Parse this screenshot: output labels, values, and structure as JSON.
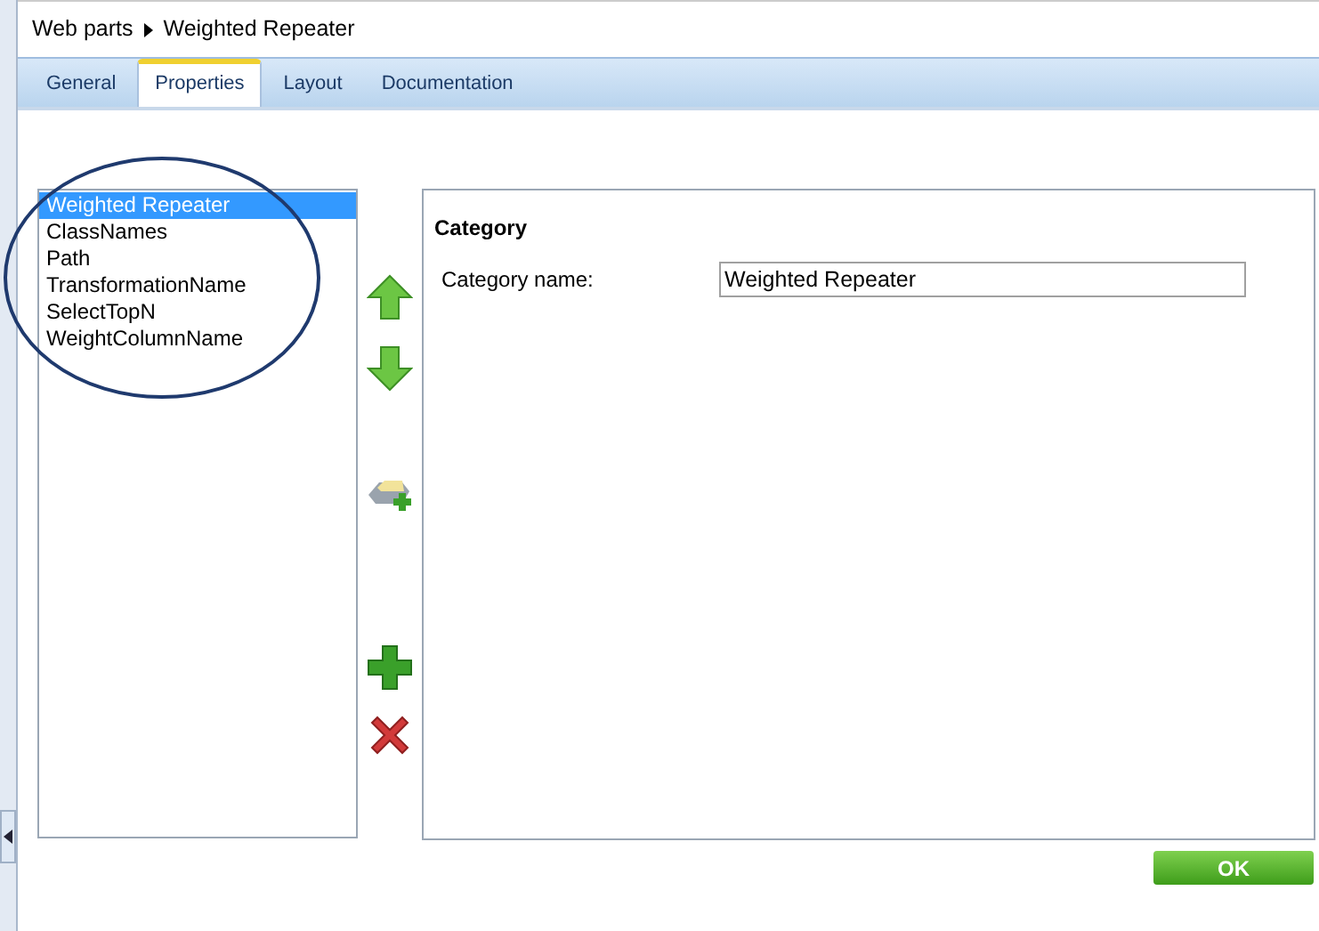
{
  "breadcrumb": {
    "link": "Web parts",
    "current": "Weighted Repeater"
  },
  "tabs": [
    {
      "label": "General",
      "selected": false
    },
    {
      "label": "Properties",
      "selected": true
    },
    {
      "label": "Layout",
      "selected": false
    },
    {
      "label": "Documentation",
      "selected": false
    }
  ],
  "property_list": [
    {
      "label": "Weighted Repeater",
      "selected": true
    },
    {
      "label": "ClassNames",
      "selected": false
    },
    {
      "label": "Path",
      "selected": false
    },
    {
      "label": "TransformationName",
      "selected": false
    },
    {
      "label": "SelectTopN",
      "selected": false
    },
    {
      "label": "WeightColumnName",
      "selected": false
    }
  ],
  "tools": [
    {
      "kind": "up"
    },
    {
      "kind": "down"
    },
    {
      "kind": "new-category"
    },
    {
      "kind": "add"
    },
    {
      "kind": "delete"
    }
  ],
  "category": {
    "heading": "Category",
    "field_label": "Category name:",
    "value": "Weighted Repeater"
  },
  "ok_button": "OK"
}
